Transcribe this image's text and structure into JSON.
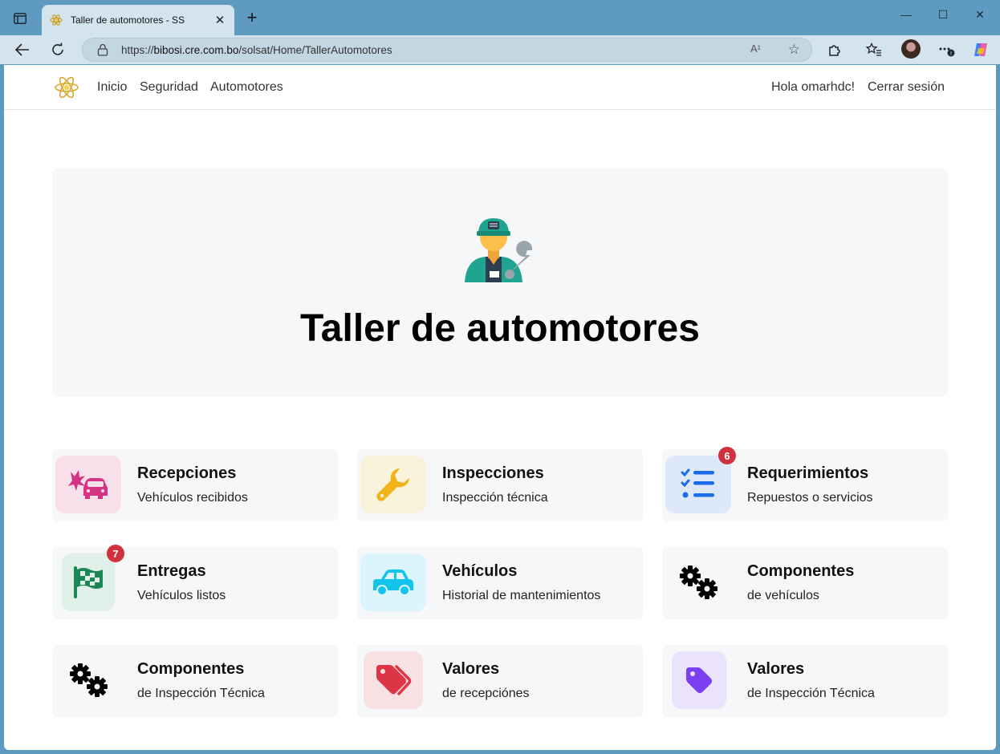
{
  "browser": {
    "tab_title": "Taller de automotores - SS",
    "tab_close": "✕",
    "new_tab": "+",
    "url_prefix": "https://",
    "url_host": "bibosi.cre.com.bo",
    "url_path": "/solsat/Home/TallerAutomotores",
    "read_aloud": "A¹",
    "window_controls": {
      "minimize": "—",
      "maximize": "☐",
      "close": "✕"
    }
  },
  "navbar": {
    "brand_icon": "atom-icon",
    "links": [
      "Inicio",
      "Seguridad",
      "Automotores"
    ],
    "greeting": "Hola omarhdc!",
    "logout": "Cerrar sesión"
  },
  "hero": {
    "icon": "mechanic-icon",
    "title": "Taller de automotores"
  },
  "cards": [
    {
      "title": "Recepciones",
      "subtitle": "Vehículos recibidos",
      "icon": "car-crash-icon",
      "color": "#d63384",
      "bg": "#f7e0ea"
    },
    {
      "title": "Inspecciones",
      "subtitle": "Inspección técnica",
      "icon": "wrench-icon",
      "color": "#f2b21a",
      "bg": "#f9f3dc"
    },
    {
      "title": "Requerimientos",
      "subtitle": "Repuestos o servicios",
      "icon": "list-check-icon",
      "color": "#1a6be8",
      "bg": "#dde9f9",
      "badge": "6"
    },
    {
      "title": "Entregas",
      "subtitle": "Vehículos listos",
      "icon": "flag-checkered-icon",
      "color": "#1a8754",
      "bg": "#e0efe8",
      "badge": "7"
    },
    {
      "title": "Vehículos",
      "subtitle": "Historial de mantenimientos",
      "icon": "car-side-icon",
      "color": "#13c4ea",
      "bg": "#dcf4fb"
    },
    {
      "title": "Componentes",
      "subtitle": "de vehículos",
      "icon": "gears-icon",
      "color": "#000000",
      "bg": "transparent"
    },
    {
      "title": "Componentes",
      "subtitle": "de Inspección Técnica",
      "icon": "gears-icon",
      "color": "#000000",
      "bg": "transparent"
    },
    {
      "title": "Valores",
      "subtitle": "de recepciónes",
      "icon": "tags-icon",
      "color": "#dc3545",
      "bg": "#f8e1e3"
    },
    {
      "title": "Valores",
      "subtitle": "de Inspección Técnica",
      "icon": "tag-icon",
      "color": "#7b3ff2",
      "bg": "#ebe2fb"
    }
  ]
}
